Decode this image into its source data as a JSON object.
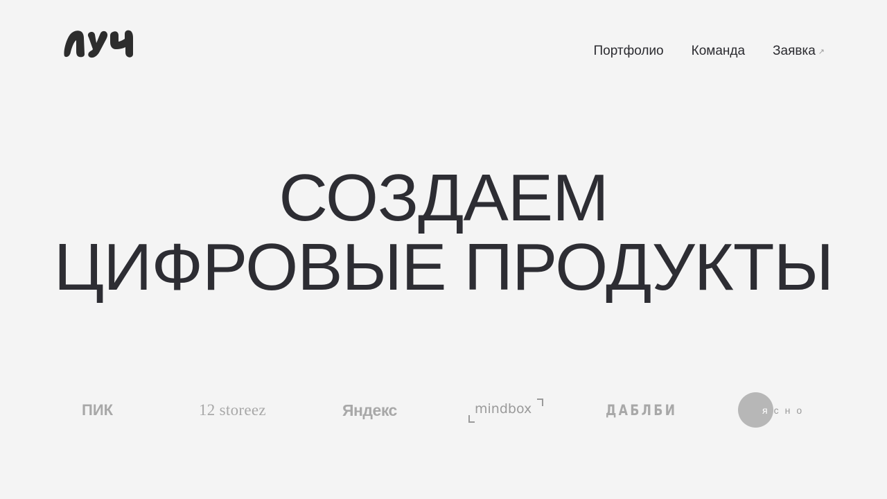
{
  "header": {
    "logo_text": "луч",
    "nav": [
      {
        "label": "Портфолио"
      },
      {
        "label": "Команда"
      },
      {
        "label": "Заявка",
        "arrow": "↗"
      }
    ]
  },
  "hero": {
    "line1": "СОЗДАЕМ",
    "line2": "ЦИФРОВЫЕ ПРОДУКТЫ"
  },
  "clients": {
    "pik": "ПИК",
    "storeez": "12 storeez",
    "yandex": "Яндекс",
    "mindbox": "mindbox",
    "dablbi": "ДАБЛБИ",
    "yasno_first": "я",
    "yasno_rest": "сно"
  },
  "colors": {
    "background": "#f4f4f4",
    "text": "#2b2b30",
    "client_logos": "#a8a8a8"
  },
  "icons": {
    "nav_arrow": "arrow-up-right-icon"
  }
}
